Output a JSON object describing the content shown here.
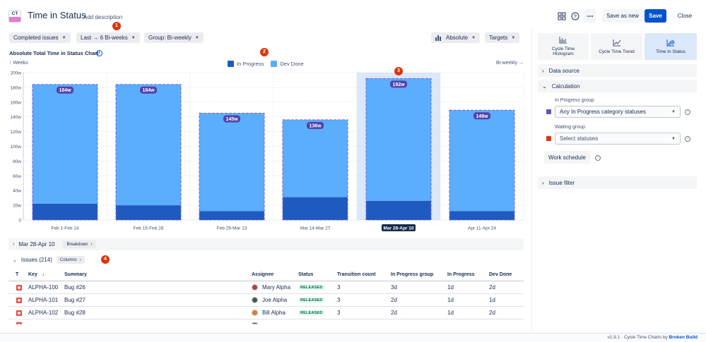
{
  "header": {
    "logo_text": "CT",
    "title": "Time in Status",
    "add_description": "Add description",
    "save_as_new": "Save as new",
    "save": "Save",
    "close": "Close",
    "icons": [
      "apps-icon",
      "help-icon",
      "more-icon"
    ]
  },
  "markers": [
    "1",
    "2",
    "3",
    "4"
  ],
  "toolbar": {
    "issue_filter": "Completed issues",
    "range": "Last → 6 Bi-weeks",
    "group": "Group: Bi-weekly",
    "mode": "Absolute",
    "targets": "Targets"
  },
  "chart_header": {
    "title": "Absolute Total Time in Status Chart",
    "y_unit": "↑ Weeks",
    "x_unit": "Bi-weekly →"
  },
  "chart_data": {
    "type": "bar",
    "stacked": true,
    "categories": [
      "Feb 1-Feb 14",
      "Feb 15-Feb 28",
      "Feb 29-Mar 13",
      "Mar 14-Mar 27",
      "Mar 28-Apr 10",
      "Apr 11-Apr 24"
    ],
    "series": [
      {
        "name": "In Progress",
        "color": "#1f5bbf",
        "values": [
          22,
          20,
          12,
          31,
          26,
          12
        ]
      },
      {
        "name": "Dev Done",
        "color": "#5aaefc",
        "values": [
          162,
          164,
          133,
          105,
          166,
          137
        ]
      }
    ],
    "totals_labels": [
      "184w",
      "184w",
      "145w",
      "136w",
      "192w",
      "149w"
    ],
    "yticks": [
      "0",
      "20w",
      "40w",
      "60w",
      "80w",
      "100w",
      "120w",
      "140w",
      "160w",
      "180w",
      "200w"
    ],
    "ylim": [
      0,
      200
    ],
    "selected_index": 4,
    "grid": true,
    "legend_position": "top-center"
  },
  "sections": {
    "breakdown_title": "Mar 28-Apr 10",
    "breakdown_btn": "Breakdown",
    "issues_title": "Issues (214)",
    "columns_btn": "Columns"
  },
  "table": {
    "headers": [
      "T",
      "Key",
      "Summary",
      "Assignee",
      "Status",
      "Transition count",
      "In Progress group",
      "In Progress",
      "Dev Done"
    ],
    "sort_indicator": "↓",
    "rows": [
      {
        "key": "ALPHA-100",
        "summary": "Bug #26",
        "assignee": "Mary Alpha",
        "avatar_color": "#b0413e",
        "status": "RELEASED",
        "transitions": "3",
        "ipg": "3d",
        "ip": "1d",
        "dd": "2d"
      },
      {
        "key": "ALPHA-101",
        "summary": "Bug #27",
        "assignee": "Joe Alpha",
        "avatar_color": "#3d5a4a",
        "status": "RELEASED",
        "transitions": "3",
        "ipg": "2d",
        "ip": "1d",
        "dd": "1d"
      },
      {
        "key": "ALPHA-102",
        "summary": "Bug #28",
        "assignee": "Bill Alpha",
        "avatar_color": "#e07a2f",
        "status": "RELEASED",
        "transitions": "3",
        "ipg": "2d",
        "ip": "1d",
        "dd": "2d"
      }
    ]
  },
  "right_panel": {
    "tabs": [
      {
        "label": "Cycle Time Histogram",
        "icon": "histogram-icon",
        "active": false
      },
      {
        "label": "Cycle Time Trend",
        "icon": "trend-icon",
        "active": false
      },
      {
        "label": "Time In Status",
        "icon": "time-in-status-icon",
        "active": true
      }
    ],
    "data_source": "Data source",
    "calculation": "Calculation",
    "in_progress_group_label": "In Progress group",
    "in_progress_group_value": "Any In Progress category statuses",
    "waiting_group_label": "Waiting group",
    "waiting_group_placeholder": "Select statuses",
    "work_schedule": "Work schedule",
    "issue_filter": "Issue filter"
  },
  "footer": {
    "version": "v1.9.1 · Cycle Time Charts by ",
    "vendor": "Broken Build"
  },
  "colors": {
    "accent": "#0052cc",
    "in_progress": "#1f5bbf",
    "dev_done": "#5aaefc",
    "selection": "#dbe7fa",
    "marker": "#de350b"
  }
}
